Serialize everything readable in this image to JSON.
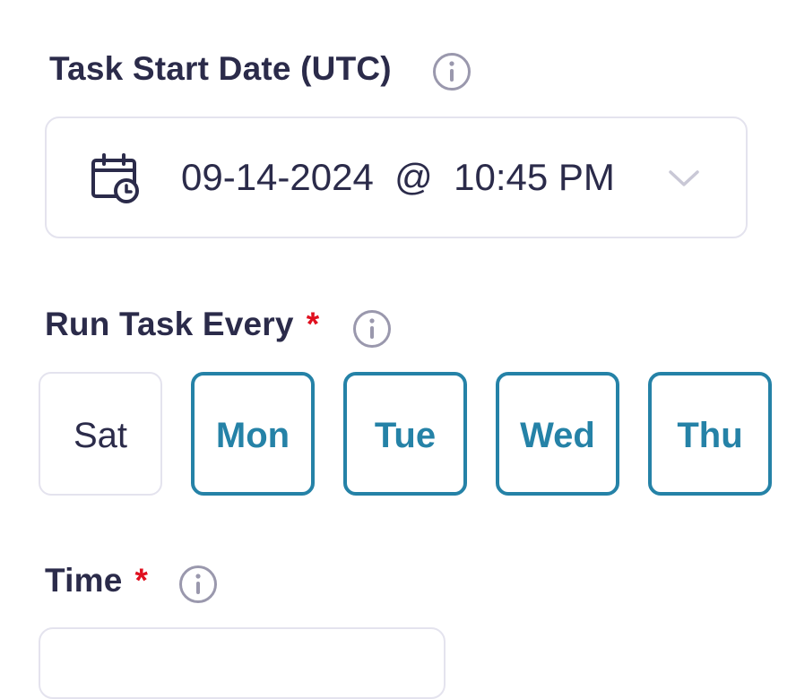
{
  "start_date": {
    "label": "Task Start Date (UTC)",
    "info_icon": "info-circle-icon",
    "field_icon": "calendar-clock-icon",
    "value": "09-14-2024  @  10:45 PM",
    "dropdown_icon": "chevron-down-icon"
  },
  "run_every": {
    "label": "Run Task Every",
    "required_marker": "*",
    "info_icon": "info-circle-icon",
    "days": [
      {
        "label": "Sat",
        "selected": false
      },
      {
        "label": "Mon",
        "selected": true
      },
      {
        "label": "Tue",
        "selected": true
      },
      {
        "label": "Wed",
        "selected": true
      },
      {
        "label": "Thu",
        "selected": true
      }
    ]
  },
  "time": {
    "label": "Time",
    "required_marker": "*",
    "info_icon": "info-circle-icon"
  },
  "colors": {
    "text": "#2b2b4a",
    "accent": "#2582a7",
    "required": "#e0101f",
    "border": "#e4e3ee",
    "icon_muted": "#9a98ad"
  }
}
